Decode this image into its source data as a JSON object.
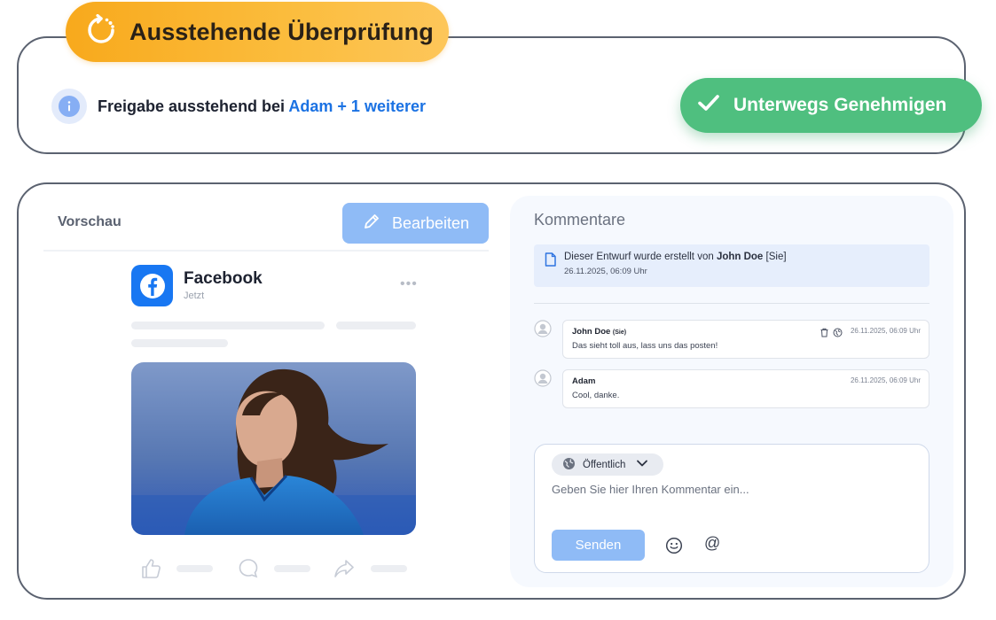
{
  "status": {
    "pending_label": "Ausstehende Überprüfung",
    "info_prefix": "Freigabe ausstehend bei",
    "info_link": "Adam + 1 weiterer",
    "approve_label": "Unterwegs Genehmigen"
  },
  "preview": {
    "title": "Vorschau",
    "edit_label": "Bearbeiten",
    "platform": "Facebook",
    "post_time": "Jetzt",
    "more_label": "•••"
  },
  "comments": {
    "title": "Kommentare",
    "draft_prefix": "Dieser Entwurf wurde erstellt von",
    "draft_author": "John Doe",
    "draft_author_tag": "[Sie]",
    "draft_time": "26.11.2025, 06:09 Uhr",
    "items": [
      {
        "author": "John Doe",
        "author_tag": "(Sie)",
        "text": "Das sieht toll aus, lass uns das posten!",
        "time": "26.11.2025, 06:09 Uhr"
      },
      {
        "author": "Adam",
        "author_tag": "",
        "text": "Cool, danke.",
        "time": "26.11.2025, 06:09 Uhr"
      }
    ],
    "visibility": "Öffentlich",
    "placeholder": "Geben Sie hier Ihren Kommentar ein...",
    "send_label": "Senden",
    "mention_symbol": "@"
  },
  "colors": {
    "pending": "#f8a91c",
    "approve": "#4fbf7f",
    "link": "#1b72e3",
    "button_blue": "#8fbbf6",
    "facebook": "#1877f2"
  }
}
